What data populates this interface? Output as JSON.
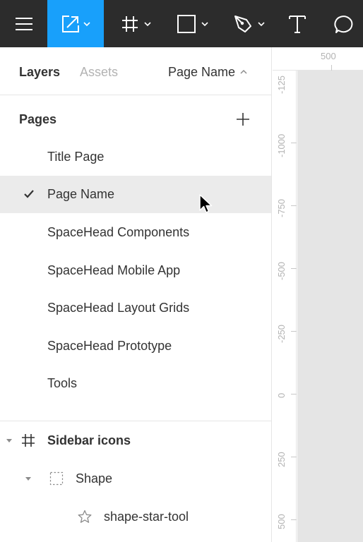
{
  "toolbar": {
    "items": [
      {
        "icon": "menu-icon"
      },
      {
        "icon": "move-tool-icon",
        "active": true
      },
      {
        "icon": "frame-tool-icon"
      },
      {
        "icon": "shape-tool-icon"
      },
      {
        "icon": "pen-tool-icon"
      },
      {
        "icon": "text-tool-icon"
      },
      {
        "icon": "comment-tool-icon"
      }
    ],
    "active_color": "#18a0fb",
    "background": "#2c2c2c"
  },
  "panel": {
    "tabs": {
      "layers": "Layers",
      "assets": "Assets"
    },
    "page_switcher": "Page Name",
    "pages_header": "Pages",
    "pages": [
      {
        "label": "Title Page",
        "selected": false
      },
      {
        "label": "Page Name",
        "selected": true
      },
      {
        "label": "SpaceHead Components",
        "selected": false
      },
      {
        "label": "SpaceHead Mobile App",
        "selected": false
      },
      {
        "label": "SpaceHead Layout Grids",
        "selected": false
      },
      {
        "label": "SpaceHead Prototype",
        "selected": false
      },
      {
        "label": "Tools",
        "selected": false
      }
    ],
    "layers": [
      {
        "label": "Sidebar icons",
        "type": "frame",
        "bold": true
      },
      {
        "label": "Shape",
        "type": "group"
      },
      {
        "label": "shape-star-tool",
        "type": "star"
      }
    ]
  },
  "ruler": {
    "top_label": "500",
    "left_labels": [
      "-125",
      "-1000",
      "-750",
      "-500",
      "-250",
      "0",
      "250",
      "500"
    ]
  }
}
